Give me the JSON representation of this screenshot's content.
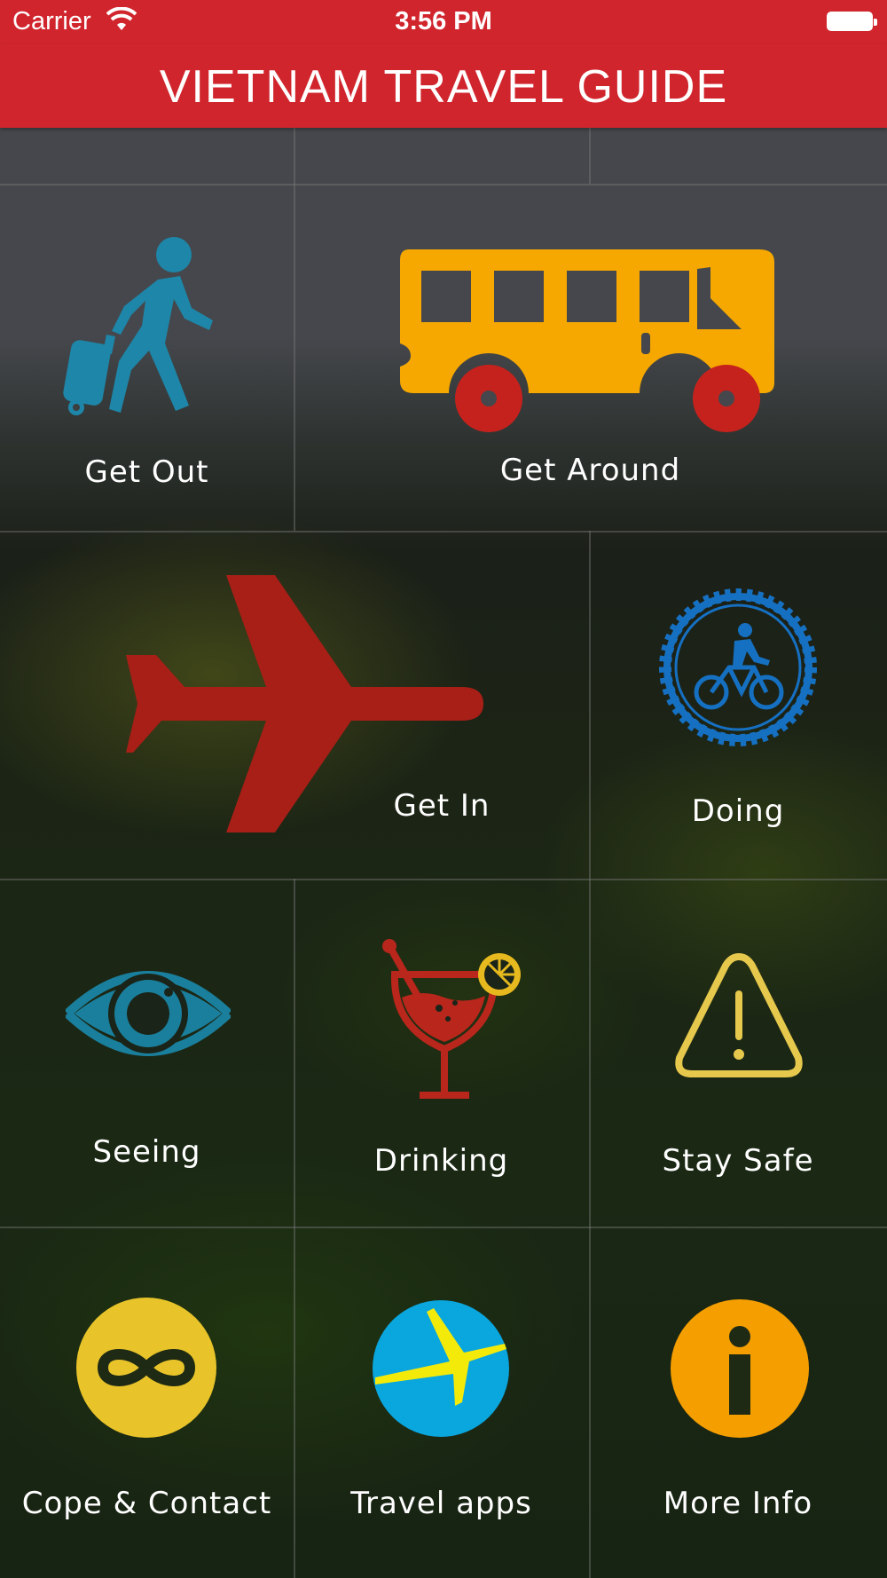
{
  "status_bar": {
    "carrier": "Carrier",
    "time": "3:56 PM"
  },
  "header": {
    "title": "VIETNAM TRAVEL GUIDE"
  },
  "tiles": [
    {
      "label": "Get Out",
      "icon": "walking-traveler-icon",
      "color": "#1e86a8"
    },
    {
      "label": "Get Around",
      "icon": "bus-icon",
      "color": "#f6a800"
    },
    {
      "label": "Get In",
      "icon": "airplane-icon",
      "color": "#a71f17"
    },
    {
      "label": "Doing",
      "icon": "cycling-gear-icon",
      "color": "#1670c2"
    },
    {
      "label": "Seeing",
      "icon": "eye-icon",
      "color": "#1a7f9c"
    },
    {
      "label": "Drinking",
      "icon": "cocktail-icon",
      "color": "#b8261c"
    },
    {
      "label": "Stay Safe",
      "icon": "warning-icon",
      "color": "#e6c84c"
    },
    {
      "label": "Cope & Contact",
      "icon": "infinity-icon",
      "color": "#e8c42a"
    },
    {
      "label": "Travel apps",
      "icon": "expedia-plane-icon",
      "color": "#0aa6de"
    },
    {
      "label": "More Info",
      "icon": "info-icon",
      "color": "#f59e00"
    }
  ]
}
